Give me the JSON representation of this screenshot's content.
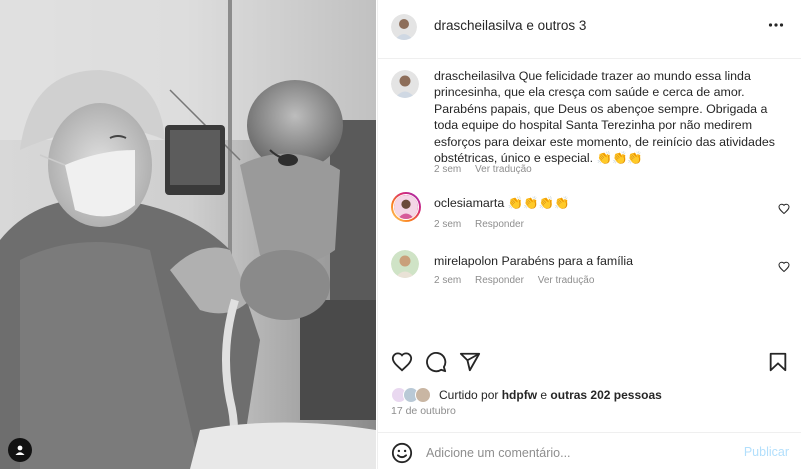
{
  "header": {
    "username": "drascheilasilva",
    "conjunction": "e",
    "others": "outros 3",
    "more_icon": "more-horizontal-icon"
  },
  "comments": [
    {
      "username": "drascheilasilva",
      "text": "Que felicidade trazer ao mundo essa linda princesinha, que ela cresça com saúde e cerca de amor. Parabéns papais, que Deus os abençoe sempre. Obrigada a toda equipe do hospital Santa Terezinha por não medirem esforços para deixar este momento, de reinício das atividades obstétricas, único e especial. 👏👏👏",
      "time": "2 sem",
      "translate": "Ver tradução"
    },
    {
      "username": "oclesiamarta",
      "text": "👏👏👏👏",
      "time": "2 sem",
      "reply": "Responder"
    },
    {
      "username": "mirelapolon",
      "text": "Parabéns para a família",
      "time": "2 sem",
      "reply": "Responder",
      "translate": "Ver tradução"
    }
  ],
  "likes": {
    "prefix": "Curtido por",
    "user": "hdpfw",
    "conjunction": "e",
    "others": "outras 202 pessoas"
  },
  "date": "17 de outubro",
  "add_comment": {
    "placeholder": "Adicione um comentário...",
    "post_label": "Publicar"
  },
  "colors": {
    "post_button_disabled": "#b2dffc",
    "meta_text": "#8e8e8e",
    "border": "#efefef",
    "story_ring_start": "#feda75",
    "story_ring_end": "#d62976"
  }
}
